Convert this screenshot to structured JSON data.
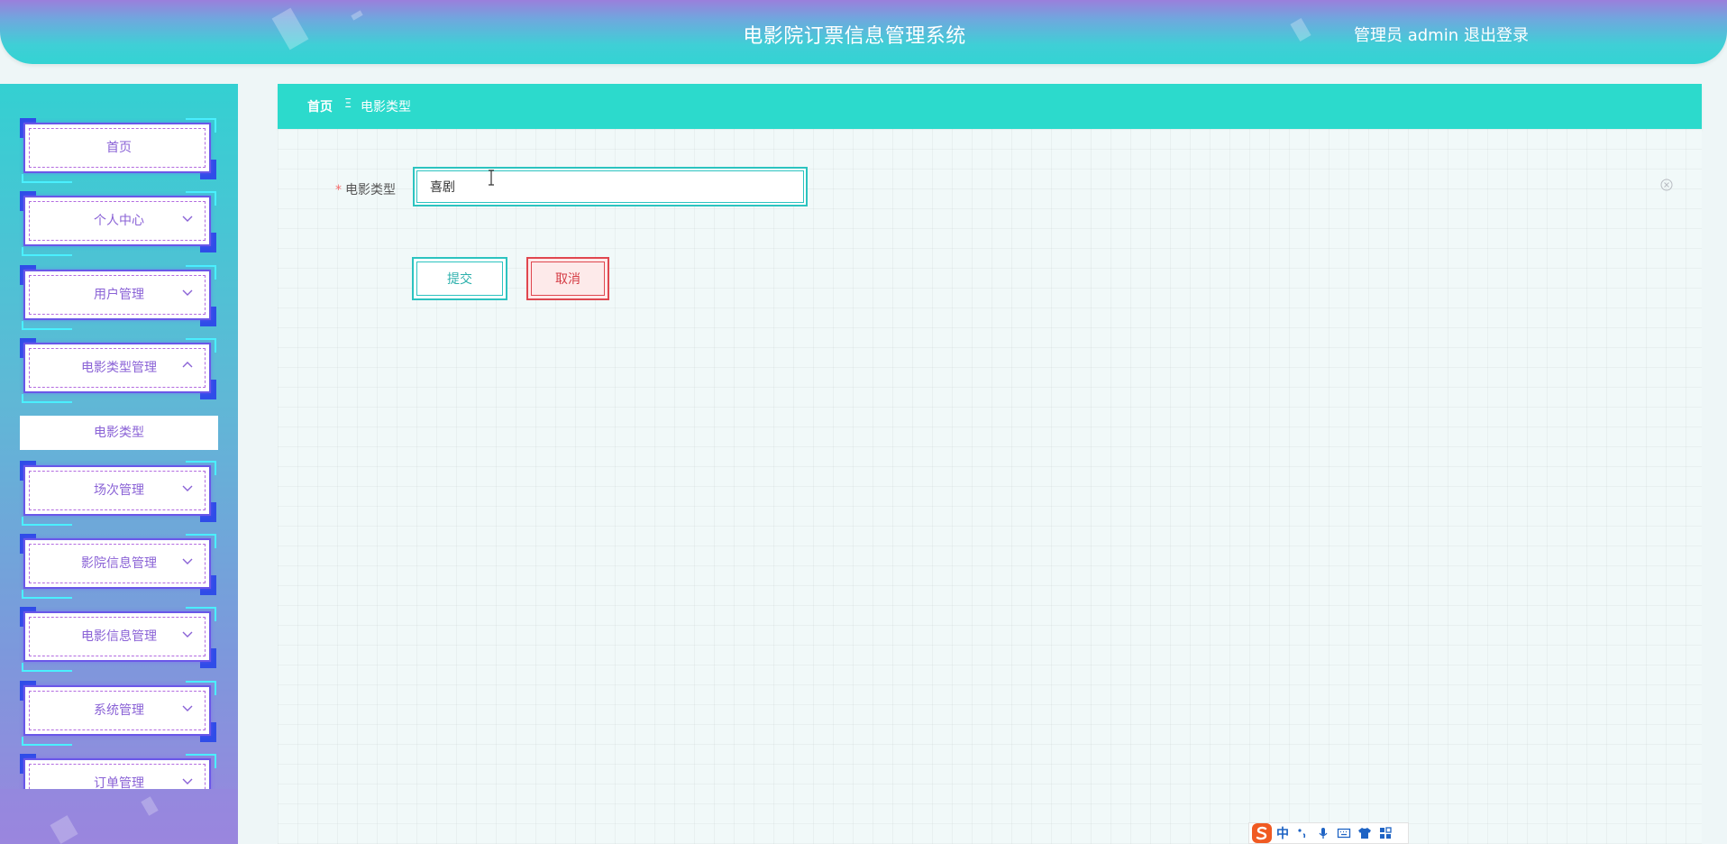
{
  "header": {
    "title": "电影院订票信息管理系统",
    "user_label": "管理员 admin",
    "logout_label": "退出登录"
  },
  "sidebar": {
    "items": [
      {
        "label": "首页"
      },
      {
        "label": "个人中心"
      },
      {
        "label": "用户管理"
      },
      {
        "label": "电影类型管理"
      },
      {
        "label": "场次管理"
      },
      {
        "label": "影院信息管理"
      },
      {
        "label": "电影信息管理"
      },
      {
        "label": "系统管理"
      },
      {
        "label": "订单管理"
      }
    ],
    "submenu": {
      "label": "电影类型"
    }
  },
  "breadcrumb": {
    "home": "首页",
    "separator": "Ξ",
    "current": "电影类型"
  },
  "form": {
    "field_label": "电影类型",
    "required_mark": "*",
    "field_value": "喜剧",
    "submit_label": "提交",
    "cancel_label": "取消"
  },
  "ime": {
    "mode": "中"
  },
  "colors": {
    "accent": "#2cdacc",
    "menu_text": "#8a62d6",
    "danger": "#e0474f",
    "frame_blue": "#2f4de8"
  }
}
